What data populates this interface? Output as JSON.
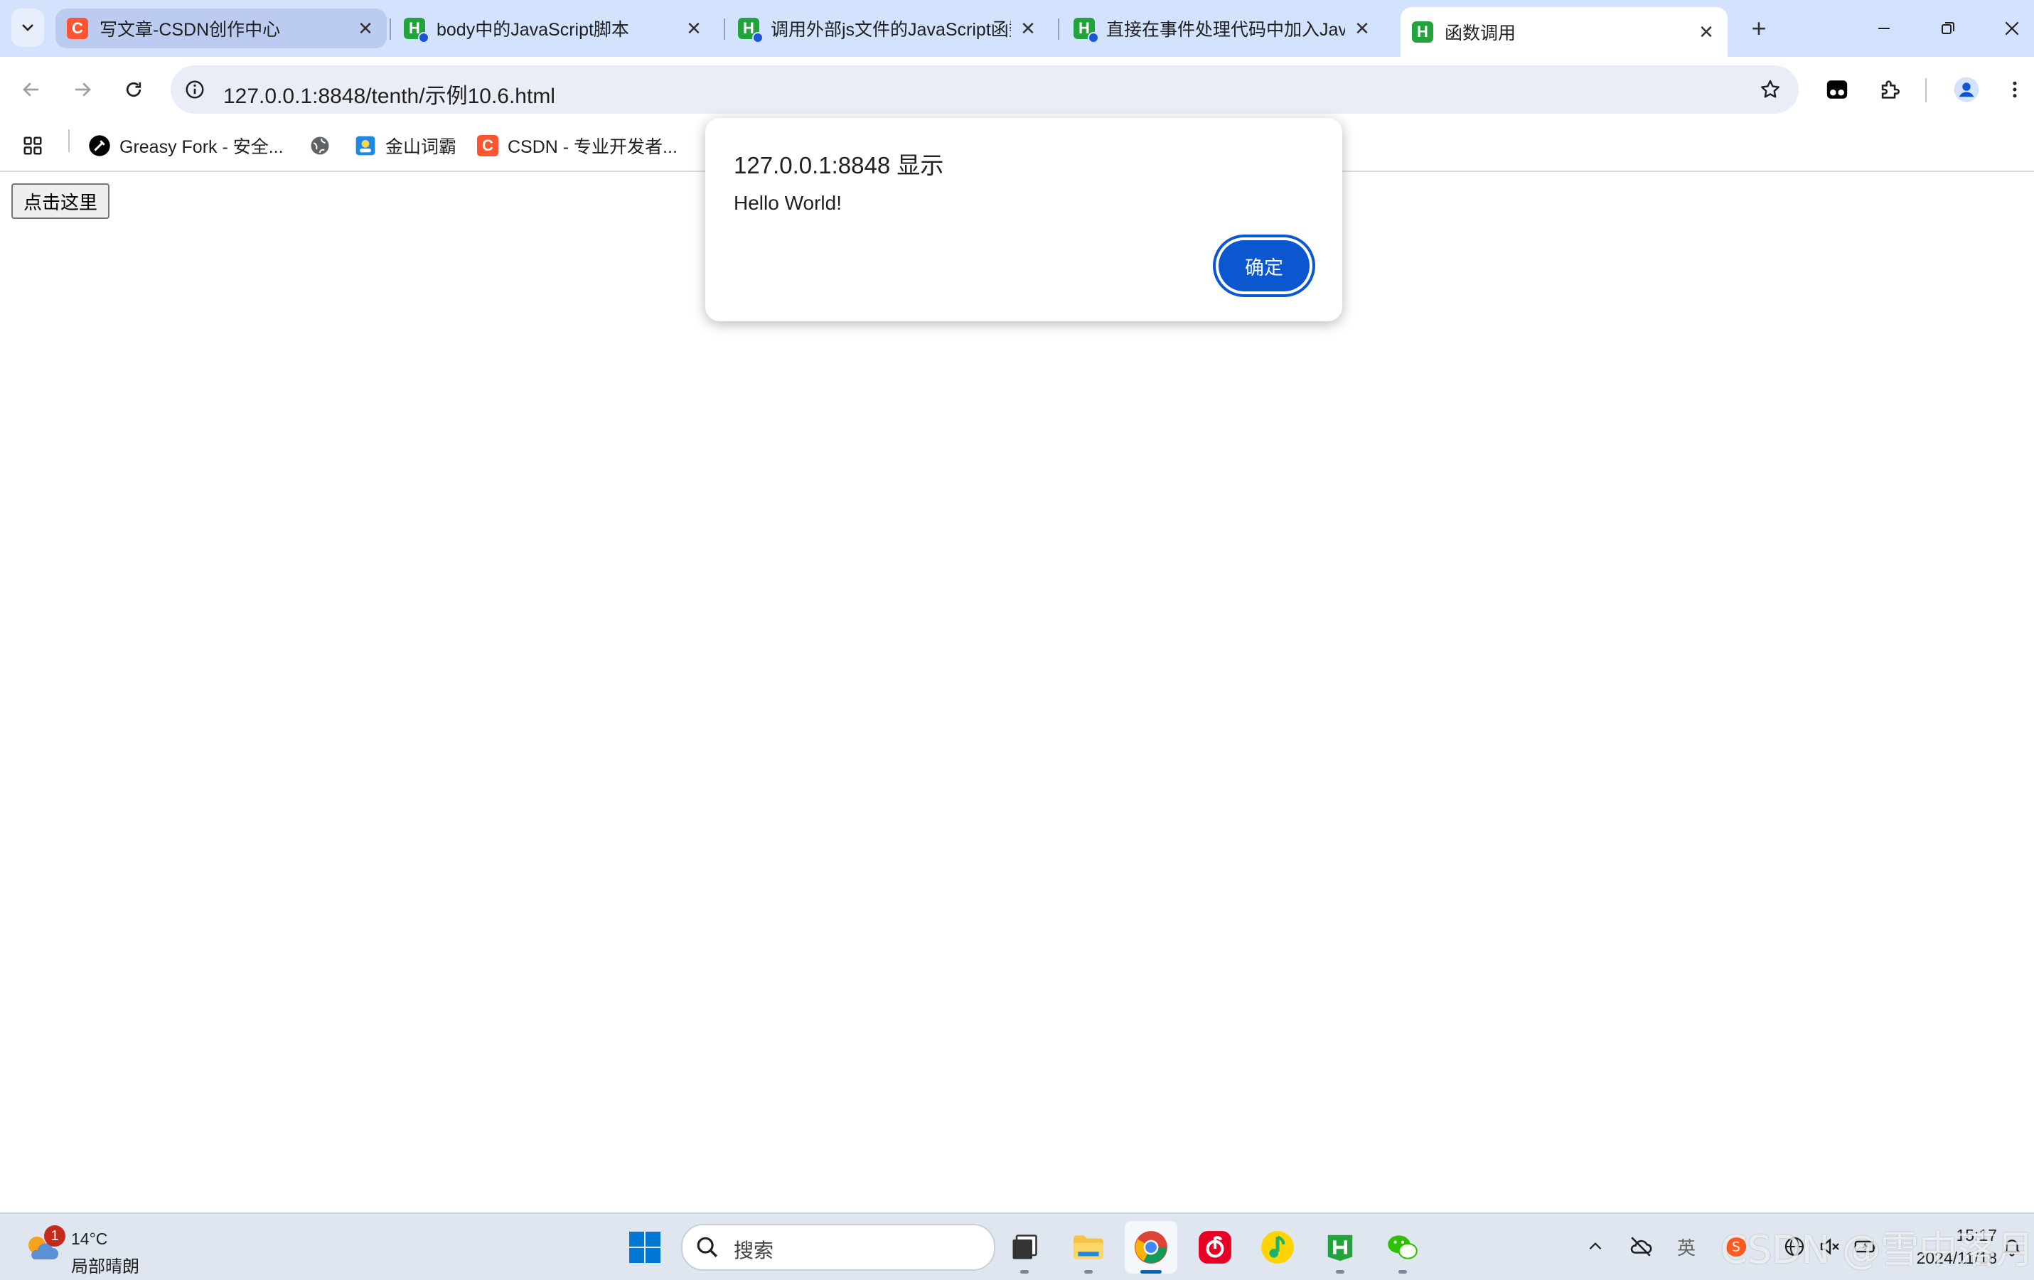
{
  "browser": {
    "tabs": [
      {
        "title": "写文章-CSDN创作中心",
        "favicon": "csdn-icon",
        "state": "hover"
      },
      {
        "title": "body中的JavaScript脚本",
        "favicon": "hbuilder-icon",
        "state": "normal"
      },
      {
        "title": "调用外部js文件的JavaScript函数",
        "favicon": "hbuilder-icon",
        "state": "normal"
      },
      {
        "title": "直接在事件处理代码中加入JavaScript",
        "favicon": "hbuilder-icon",
        "state": "normal"
      },
      {
        "title": "函数调用",
        "favicon": "hbuilder-icon",
        "state": "active"
      }
    ],
    "url": "127.0.0.1:8848/tenth/示例10.6.html",
    "bookmarks": [
      {
        "label": "Greasy Fork - 安全...",
        "icon": "greasyfork-icon"
      },
      {
        "label": "",
        "icon": "globe-icon"
      },
      {
        "label": "金山词霸",
        "icon": "iciba-icon"
      },
      {
        "label": "CSDN - 专业开发者...",
        "icon": "csdn-icon"
      }
    ]
  },
  "page": {
    "button_label": "点击这里"
  },
  "dialog": {
    "title": "127.0.0.1:8848 显示",
    "message": "Hello World!",
    "ok_label": "确定"
  },
  "taskbar": {
    "weather": {
      "badge": "1",
      "temp": "14°C",
      "condition": "局部晴朗"
    },
    "search_placeholder": "搜索",
    "apps": [
      "task-view-icon",
      "file-explorer-icon",
      "chrome-icon",
      "netease-music-icon",
      "qq-music-icon",
      "hbuilder-icon",
      "wechat-icon"
    ],
    "tray": {
      "ime": "英"
    },
    "clock": {
      "time": "15:17",
      "date": "2024/11/18"
    },
    "watermark": "CSDN @雪中落月"
  },
  "colors": {
    "tabstrip": "#d3e3fd",
    "accent": "#0b57d0",
    "csdn": "#fc5531",
    "hbuilder": "#22a33b"
  }
}
